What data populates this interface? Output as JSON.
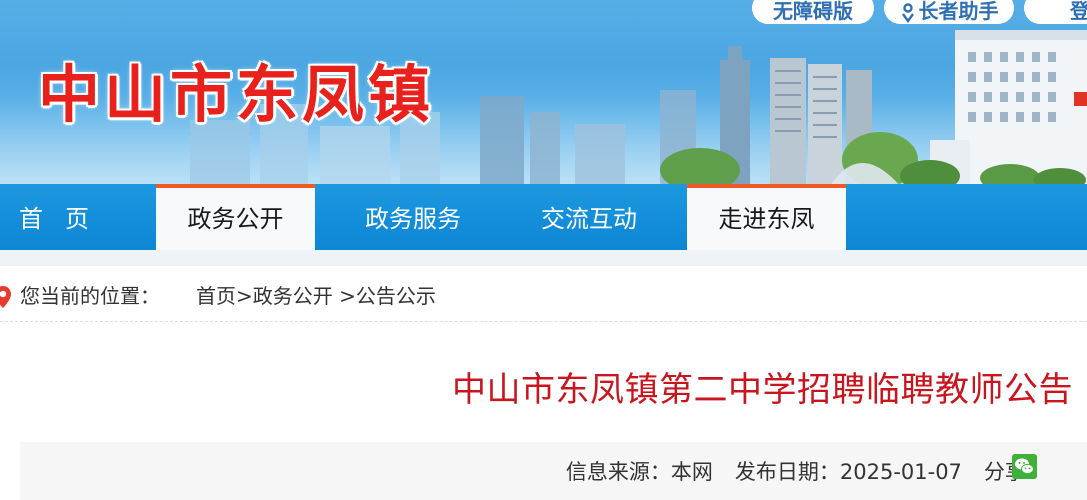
{
  "header": {
    "site_title": "中山市东凤镇",
    "accessibility_label": "无障碍版",
    "elder_assist_label": "长者助手",
    "login_label": "登"
  },
  "nav": {
    "items": [
      {
        "label": "首页",
        "active": false
      },
      {
        "label": "政务公开",
        "active": true
      },
      {
        "label": "政务服务",
        "active": false
      },
      {
        "label": "交流互动",
        "active": false
      },
      {
        "label": "走进东凤",
        "active": true
      }
    ]
  },
  "breadcrumb": {
    "label": "您当前的位置：",
    "items": [
      "首页",
      ">",
      "政务公开",
      " >",
      "公告公示"
    ]
  },
  "article": {
    "title": "中山市东凤镇第二中学招聘临聘教师公告",
    "source_label": "信息来源：",
    "source_value": "本网",
    "date_label": "发布日期：",
    "date_value": "2025-01-07",
    "share_label": "分享:"
  },
  "colors": {
    "title_red": "#e8211c",
    "nav_blue": "#0d86d4",
    "active_tab_border": "#f15a24",
    "article_title_red": "#c9151e",
    "wechat_green": "#3fb13b"
  },
  "icons": {
    "breadcrumb": "map-pin-icon",
    "share": "wechat-icon",
    "elder": "elder-helper-icon"
  }
}
